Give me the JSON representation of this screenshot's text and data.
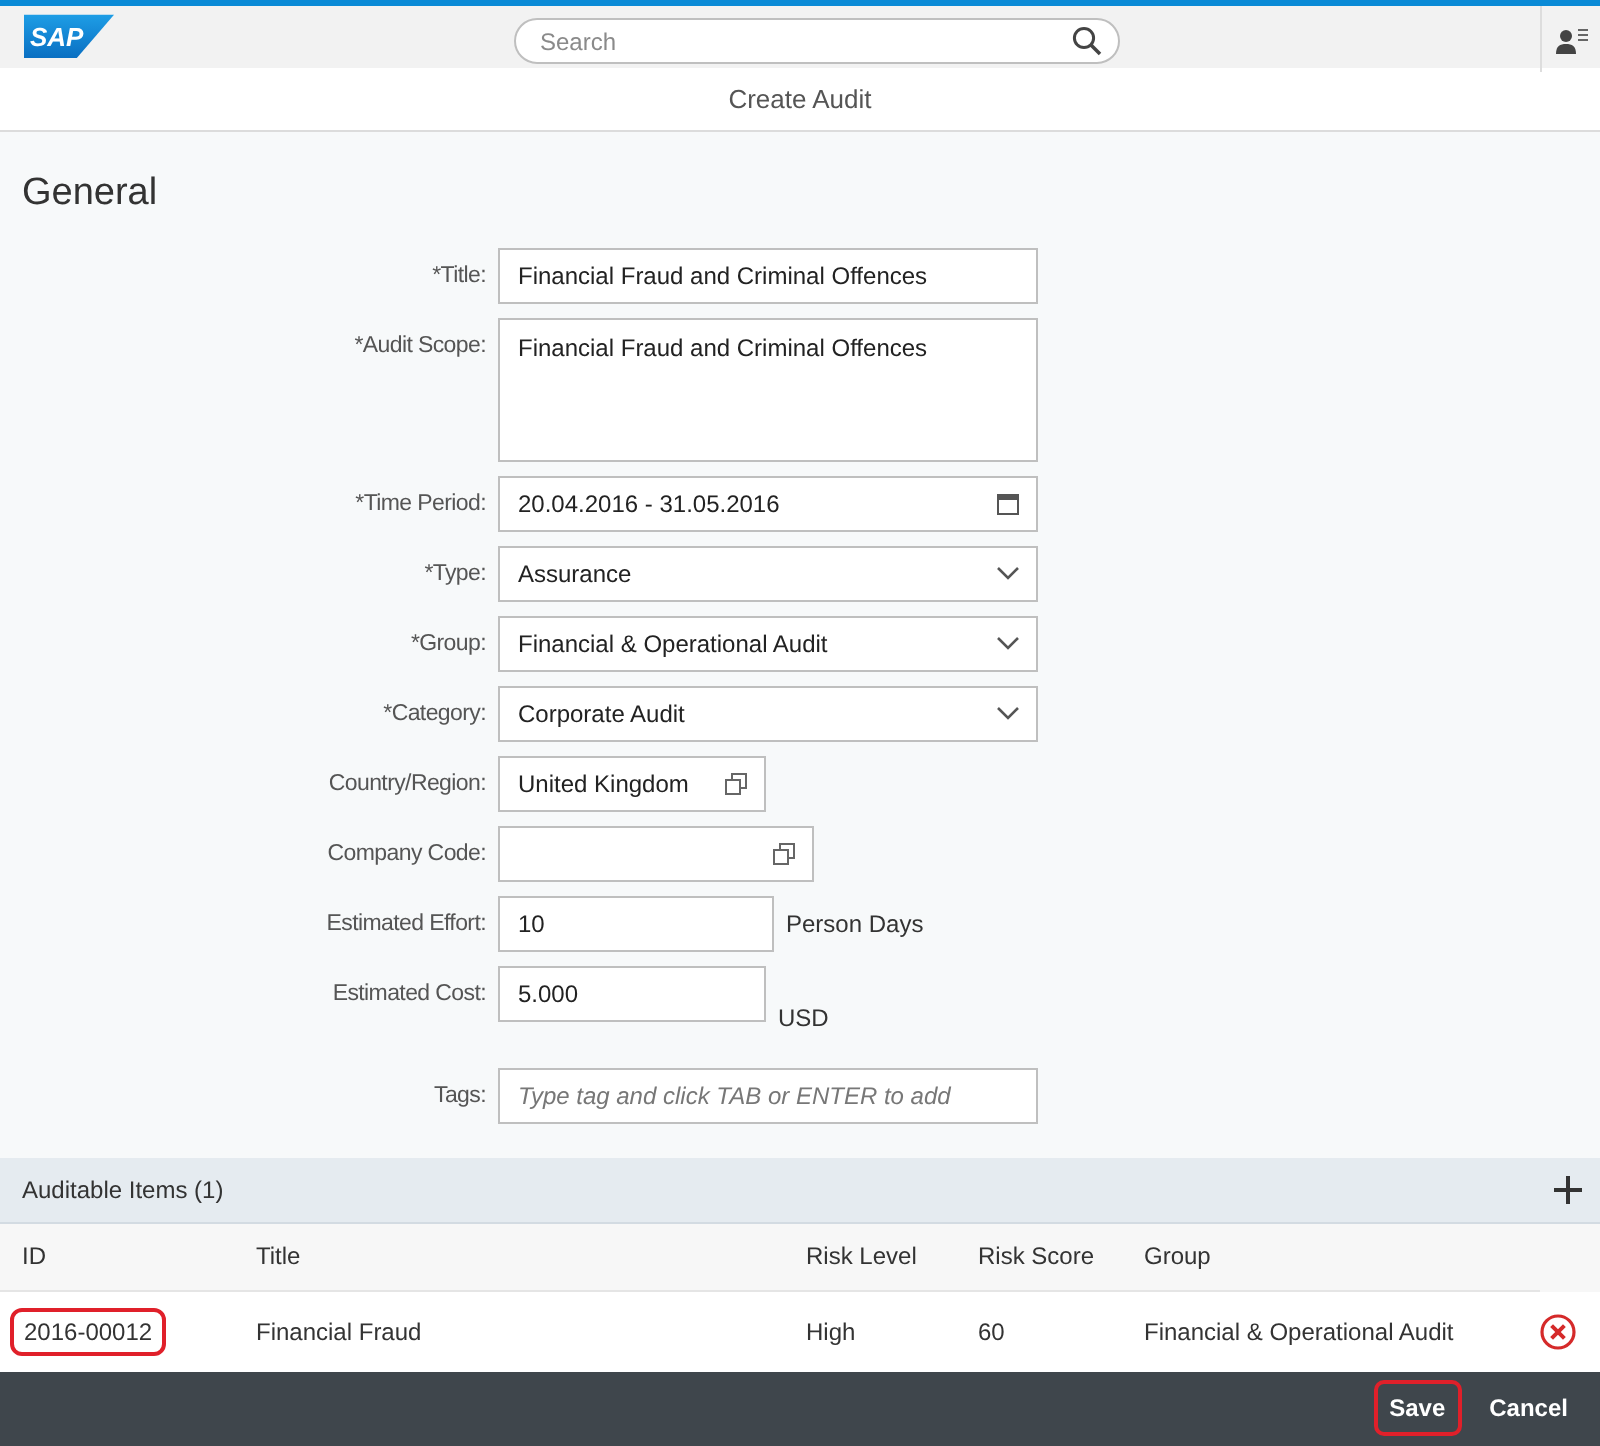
{
  "shell": {
    "logo": "SAP",
    "search": {
      "placeholder": "Search"
    }
  },
  "page_title": "Create Audit",
  "section_title": "General",
  "form": [
    {
      "label": "*Title:",
      "kind": "text",
      "value": "Financial Fraud and Criminal Offences"
    },
    {
      "label": "*Audit Scope:",
      "kind": "textarea",
      "value": "Financial Fraud and Criminal Offences"
    },
    {
      "label": "*Time Period:",
      "kind": "date",
      "value": "20.04.2016 - 31.05.2016"
    },
    {
      "label": "*Type:",
      "kind": "select",
      "value": "Assurance"
    },
    {
      "label": "*Group:",
      "kind": "select",
      "value": "Financial & Operational Audit"
    },
    {
      "label": "*Category:",
      "kind": "select",
      "value": "Corporate Audit"
    },
    {
      "label": "Country/Region:",
      "kind": "valuehelp",
      "value": "United Kingdom"
    },
    {
      "label": "Company Code:",
      "kind": "valuehelp"
    },
    {
      "label": "Estimated Effort:",
      "kind": "unit",
      "value": "10",
      "unit": "Person Days"
    },
    {
      "label": "Estimated Cost:",
      "kind": "unit",
      "value": "5.000",
      "unit": "USD"
    },
    {
      "label": "Tags:",
      "kind": "text",
      "placeholder": "Type tag and click TAB or ENTER to add"
    }
  ],
  "items": {
    "title": "Auditable Items (1)",
    "columns": [
      "ID",
      "Title",
      "Risk Level",
      "Risk Score",
      "Group"
    ],
    "rows": [
      {
        "cells": [
          "2016-00012",
          "Financial Fraud",
          "High",
          "60",
          "Financial & Operational Audit"
        ],
        "highlighted": true
      }
    ]
  },
  "footer": [
    {
      "label": "Save",
      "highlighted": true
    },
    {
      "label": "Cancel",
      "highlighted": false
    }
  ]
}
